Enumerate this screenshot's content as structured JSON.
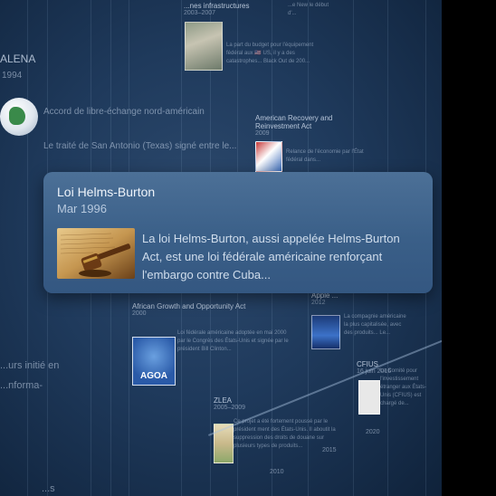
{
  "app": {
    "name": "timeline-viewer"
  },
  "background_events": {
    "top_header": "...nes infrastructures",
    "top_header_date": "2003–2007",
    "top_body": "La part du budget pour l'équipement fédéral aux 🇺🇸 US, il y a des catastrophes... Black Out de 200...",
    "top_right": "...e New le début d'...",
    "left_title": "ALENA",
    "left_date": "1994",
    "alena_desc_1": "Accord de libre-échange nord-américain",
    "alena_desc_2": "Le traité de San Antonio (Texas) signé entre le...",
    "arra_title": "American Recovery and Reinvestment Act",
    "arra_date": "2009",
    "arra_body": "Relance de l'économie par l'État fédéral dans...",
    "agoa_title": "African Growth and Opportunity Act",
    "agoa_date": "2000",
    "agoa_body": "Loi fédérale américaine adoptée en mai 2000 par le Congrès des États-Unis et signée par le président Bill Clinton...",
    "agoa_logo": "AGOA",
    "right_small_title": "Apple ...",
    "right_small_date": "2012",
    "right_small_body": "La compagnie américaine la plus capitalisée, avec des produits... Le...",
    "left_bottom_1": "...urs initié en",
    "left_bottom_2": "...nforma-",
    "left_bottom_3": "...s",
    "zlea_title": "ZLEA",
    "zlea_date": "2005–2009",
    "zlea_body": "Ce projet a été fortement poussé par le président ment des États-Unis. Il aboutit la suppression des droits de douane sur plusieurs types de produits...",
    "cfius_title": "CFIUS",
    "cfius_date": "16 juin 2016",
    "cfius_body": "Le Comité pour l'investissement étranger aux États-Unis (CFIUS) est chargé de..."
  },
  "axis": {
    "ticks": [
      "2010",
      "2015",
      "2020"
    ]
  },
  "popup": {
    "title": "Loi Helms-Burton",
    "date": "Mar 1996",
    "description": "La loi Helms-Burton, aussi appelée Helms-Burton Act, est une loi fédérale américaine renforçant l'embargo contre Cuba..."
  }
}
